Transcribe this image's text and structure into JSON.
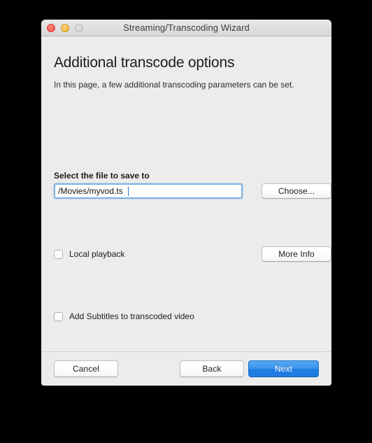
{
  "window": {
    "title": "Streaming/Transcoding Wizard",
    "controls": {
      "close": "close-button",
      "minimize": "minimize-button",
      "zoom": "zoom-button"
    }
  },
  "page": {
    "title": "Additional transcode options",
    "subtitle": "In this page, a few additional transcoding parameters can be set."
  },
  "file_section": {
    "label": "Select the file to save to",
    "path_value": "/Movies/myvod.ts",
    "path_placeholder": "",
    "choose_label": "Choose..."
  },
  "options": {
    "local_playback": {
      "label": "Local playback",
      "checked": false,
      "more_info_label": "More Info"
    },
    "subtitles": {
      "label": "Add Subtitles to transcoded video",
      "checked": false
    }
  },
  "footer": {
    "cancel_label": "Cancel",
    "back_label": "Back",
    "next_label": "Next"
  },
  "colors": {
    "accent": "#1f7de4",
    "window_bg": "#ececec",
    "focus_ring": "#7eb4e2",
    "close": "#f9655d",
    "minimize": "#f7bf4c",
    "zoom": "#d6d6d6"
  }
}
